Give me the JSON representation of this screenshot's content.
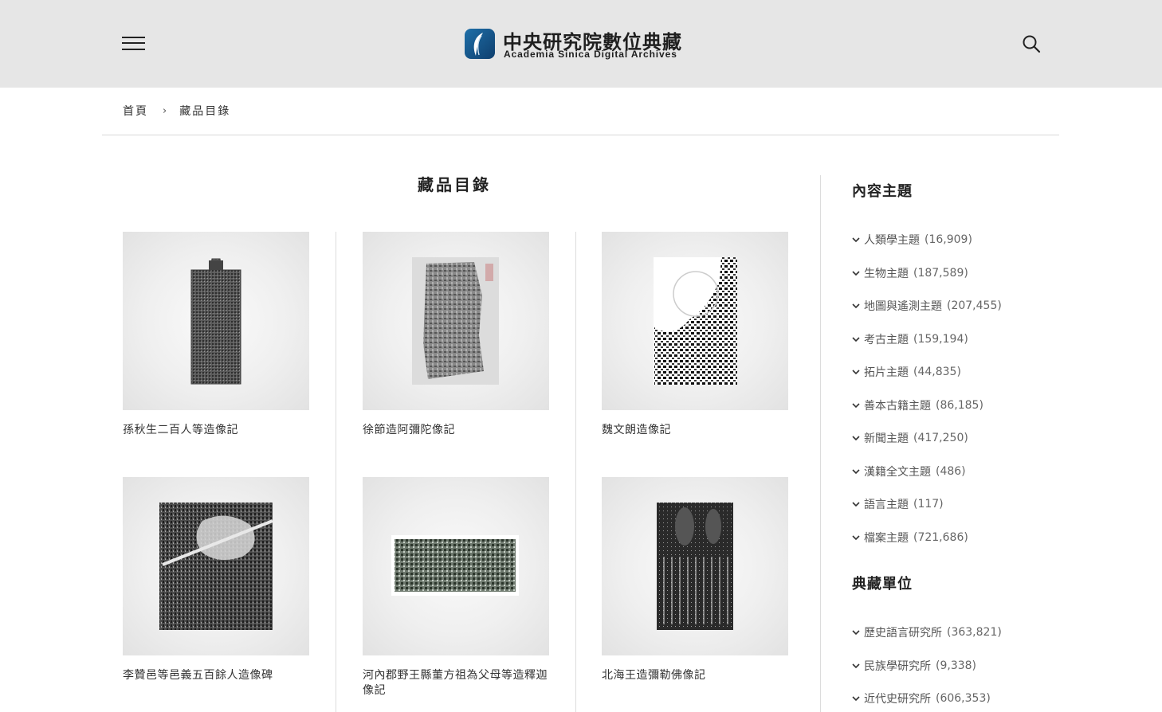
{
  "header": {
    "logo_zh": "中央研究院數位典藏",
    "logo_en": "Academia Sinica Digital Archives",
    "menu_icon": "hamburger-menu-icon",
    "search_icon": "search-icon"
  },
  "breadcrumb": {
    "home": "首頁",
    "separator": "›",
    "current": "藏品目錄"
  },
  "main": {
    "title": "藏品目錄",
    "items": [
      {
        "title": "孫秋生二百人等造像記"
      },
      {
        "title": "徐節造阿彌陀像記"
      },
      {
        "title": "魏文朗造像記"
      },
      {
        "title": "李贊邑等邑義五百餘人造像碑"
      },
      {
        "title": "河內郡野王縣董方祖為父母等造釋迦像記"
      },
      {
        "title": "北海王造彌勒佛像記"
      }
    ]
  },
  "sidebar": {
    "topics_heading": "內容主題",
    "topics": [
      {
        "label": "人類學主題",
        "count": "(16,909)"
      },
      {
        "label": "生物主題",
        "count": "(187,589)"
      },
      {
        "label": "地圖與遙測主題",
        "count": "(207,455)"
      },
      {
        "label": "考古主題",
        "count": "(159,194)"
      },
      {
        "label": "拓片主題",
        "count": "(44,835)"
      },
      {
        "label": "善本古籍主題",
        "count": "(86,185)"
      },
      {
        "label": "新聞主題",
        "count": "(417,250)"
      },
      {
        "label": "漢籍全文主題",
        "count": "(486)"
      },
      {
        "label": "語言主題",
        "count": "(117)"
      },
      {
        "label": "檔案主題",
        "count": "(721,686)"
      }
    ],
    "units_heading": "典藏單位",
    "units": [
      {
        "label": "歷史語言研究所",
        "count": "(363,821)"
      },
      {
        "label": "民族學研究所",
        "count": "(9,338)"
      },
      {
        "label": "近代史研究所",
        "count": "(606,353)"
      }
    ]
  }
}
